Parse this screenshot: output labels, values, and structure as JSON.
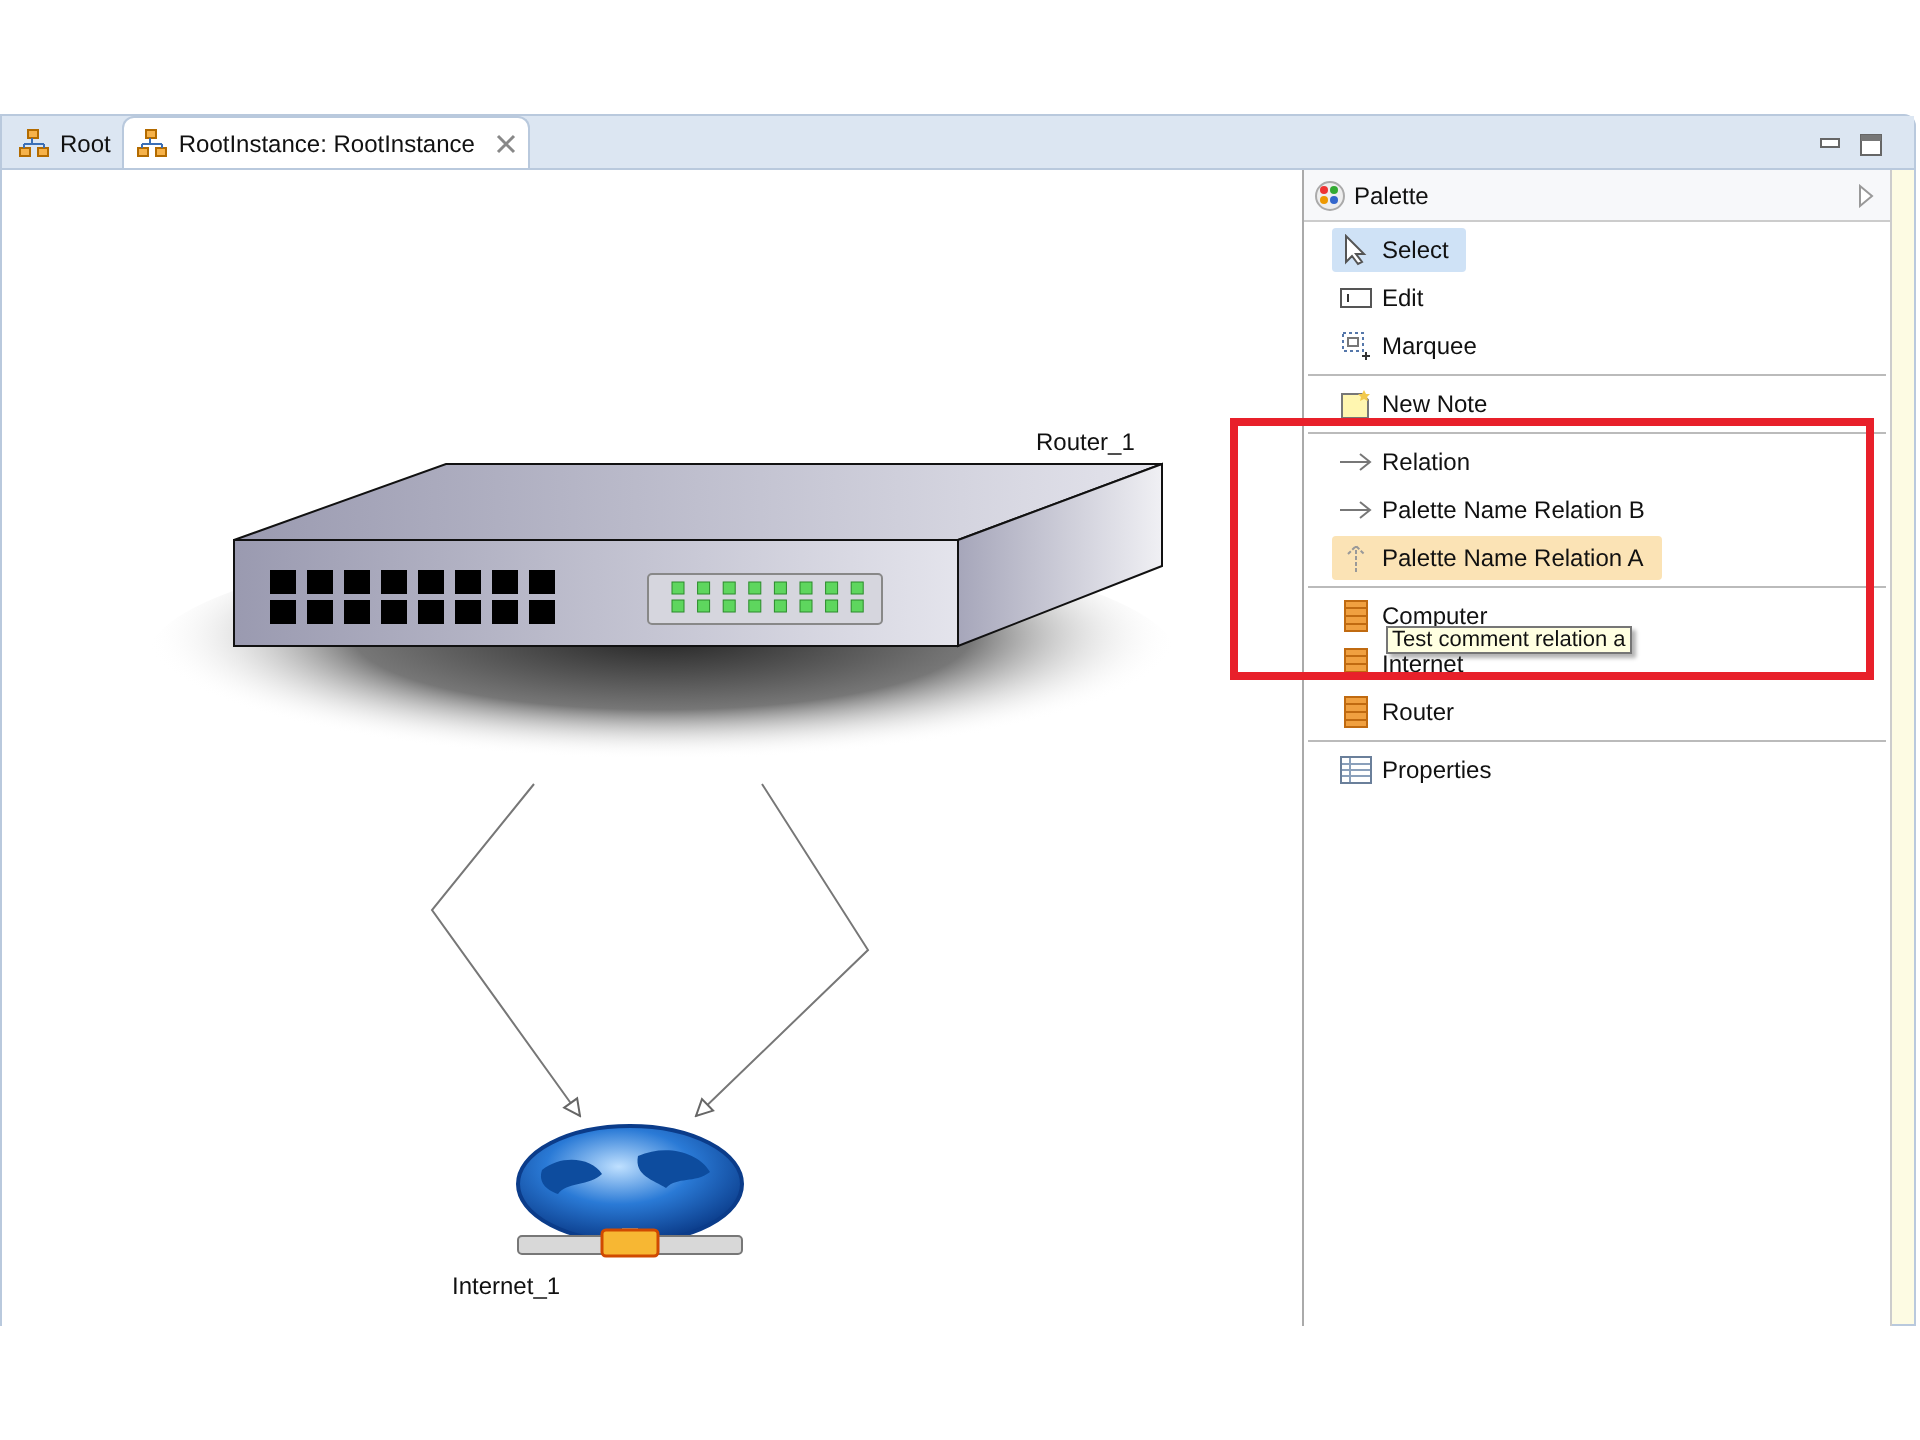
{
  "tabs": [
    {
      "label": "Root",
      "selected": false
    },
    {
      "label": "RootInstance: RootInstance",
      "selected": true
    }
  ],
  "canvas": {
    "nodes": [
      {
        "kind": "router",
        "label": "Router_1"
      },
      {
        "kind": "internet",
        "label": "Internet_1"
      }
    ]
  },
  "palette": {
    "title": "Palette",
    "groups": [
      {
        "items": [
          {
            "kind": "select",
            "label": "Select",
            "selected": true,
            "hovered": false
          },
          {
            "kind": "edit",
            "label": "Edit",
            "selected": false,
            "hovered": false
          },
          {
            "kind": "marquee",
            "label": "Marquee",
            "selected": false,
            "hovered": false
          }
        ]
      },
      {
        "items": [
          {
            "kind": "note",
            "label": "New Note",
            "selected": false,
            "hovered": false
          }
        ]
      },
      {
        "items": [
          {
            "kind": "arrow",
            "label": "Relation",
            "selected": false,
            "hovered": false
          },
          {
            "kind": "arrow",
            "label": "Palette Name Relation B",
            "selected": false,
            "hovered": false
          },
          {
            "kind": "up-arrow",
            "label": "Palette Name Relation A",
            "selected": false,
            "hovered": true
          }
        ]
      },
      {
        "items": [
          {
            "kind": "entity",
            "label": "Computer",
            "selected": false,
            "hovered": false
          },
          {
            "kind": "entity",
            "label": "Internet",
            "selected": false,
            "hovered": false
          },
          {
            "kind": "entity",
            "label": "Router",
            "selected": false,
            "hovered": false
          }
        ]
      },
      {
        "items": [
          {
            "kind": "table",
            "label": "Properties",
            "selected": false,
            "hovered": false
          }
        ]
      }
    ],
    "tooltip": "Test comment relation a"
  }
}
